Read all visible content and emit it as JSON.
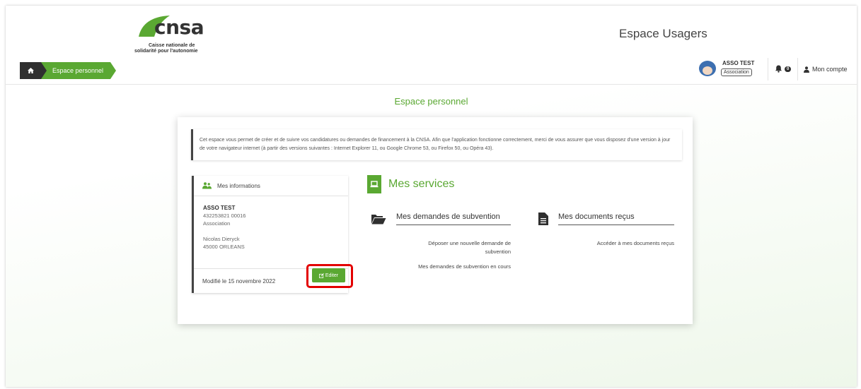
{
  "brand": {
    "logo_text": "cnsa",
    "logo_sub_line1": "Caisse nationale de",
    "logo_sub_line2": "solidarité pour l'autonomie",
    "accent": "#5aa832"
  },
  "header": {
    "app_title": "Espace Usagers",
    "breadcrumb": {
      "home_icon": "home-icon",
      "current": "Espace personnel"
    },
    "user": {
      "name": "ASSO TEST",
      "type": "Association"
    },
    "notifications": {
      "count": "0"
    },
    "account_label": "Mon compte"
  },
  "page": {
    "heading": "Espace personnel",
    "intro_text": "Cet espace vous permet de créer et de suivre vos candidatures ou demandes de financement à la CNSA. Afin que l'application fonctionne correctement, merci de vous assurer que vous disposez d'une version à jour de votre navigateur internet (à partir des versions suivantes : Internet Explorer 11, ou Google Chrome 53, ou Firefox 50, ou Opéra 43)."
  },
  "info_panel": {
    "title": "Mes informations",
    "org_name": "ASSO TEST",
    "siret": "432253821 00016",
    "org_type": "Association",
    "contact_name": "Nicolas Dieryck",
    "city": "45000 ORLEANS",
    "modified": "Modifié le 15 novembre 2022",
    "edit_label": "Editer"
  },
  "services": {
    "title": "Mes services",
    "subsidies": {
      "title": "Mes demandes de subvention",
      "link_new_line1": "Déposer une nouvelle demande de",
      "link_new_line2": "subvention",
      "link_ongoing": "Mes demandes de subvention en cours"
    },
    "documents": {
      "title": "Mes documents reçus",
      "link_access": "Accéder à mes documents reçus"
    }
  }
}
